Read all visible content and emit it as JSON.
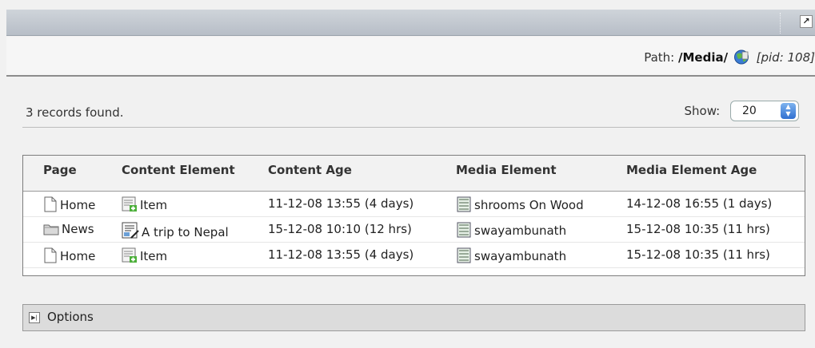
{
  "toolbar": {
    "open_new_icon": "arrow-up-right-icon"
  },
  "path": {
    "label": "Path:",
    "value": "/Media/",
    "pid": "[pid: 108]"
  },
  "summary": "3 records found.",
  "show": {
    "label": "Show:",
    "value": "20"
  },
  "table": {
    "headers": [
      "Page",
      "Content Element",
      "Content Age",
      "Media Element",
      "Media Element Age"
    ],
    "rows": [
      {
        "page": "Home",
        "page_icon": "page-icon",
        "content": "Item",
        "content_icon": "content-list-icon",
        "content_age": "11-12-08 13:55 (4 days)",
        "media": "shrooms On Wood",
        "media_icon": "media-file-icon",
        "media_age": "14-12-08 16:55 (1 days)"
      },
      {
        "page": "News",
        "page_icon": "folder-icon",
        "content": "A trip to Nepal",
        "content_icon": "text-image-icon",
        "content_age": "15-12-08 10:10 (12 hrs)",
        "media": "swayambunath",
        "media_icon": "media-file-icon",
        "media_age": "15-12-08 10:35 (11 hrs)"
      },
      {
        "page": "Home",
        "page_icon": "page-icon",
        "content": "Item",
        "content_icon": "content-list-icon",
        "content_age": "11-12-08 13:55 (4 days)",
        "media": "swayambunath",
        "media_icon": "media-file-icon",
        "media_age": "15-12-08 10:35 (11 hrs)"
      }
    ]
  },
  "options": {
    "label": "Options"
  }
}
